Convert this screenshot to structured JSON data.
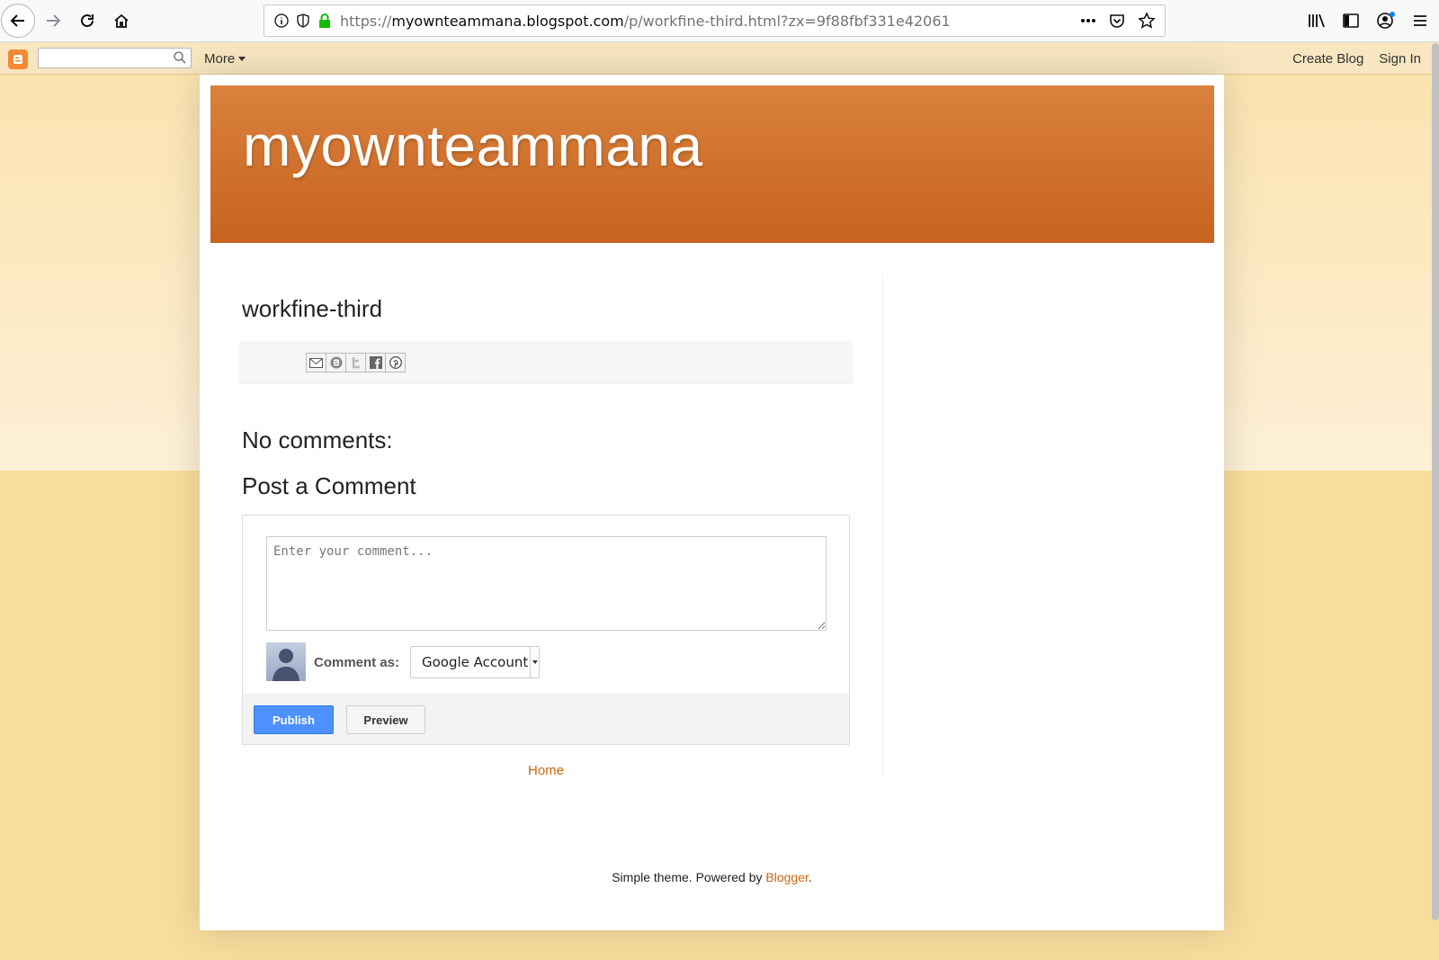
{
  "browser": {
    "url_prefix": "https://",
    "url_host": "myownteammana.blogspot.com",
    "url_path": "/p/workfine-third.html?zx=9f88fbf331e42061",
    "icons": [
      "back-icon",
      "forward-icon",
      "reload-icon",
      "home-icon",
      "info-icon",
      "tracking-shield-icon",
      "lock-icon",
      "page-actions-icon",
      "pocket-icon",
      "bookmark-star-icon",
      "library-icon",
      "sidebar-icon",
      "account-icon",
      "menu-icon"
    ]
  },
  "navbar": {
    "search_placeholder": "",
    "more_label": "More",
    "create_blog": "Create Blog",
    "sign_in": "Sign In"
  },
  "blog": {
    "title": "myownteammana"
  },
  "post": {
    "title": "workfine-third",
    "share_buttons": [
      "email-share-icon",
      "blogthis-share-icon",
      "twitter-share-icon",
      "facebook-share-icon",
      "pinterest-share-icon"
    ]
  },
  "comments": {
    "no_comments": "No comments:",
    "post_a_comment": "Post a Comment",
    "textarea_placeholder": "Enter your comment...",
    "comment_as_label": "Comment as:",
    "account_selected": "Google Account",
    "publish_label": "Publish",
    "preview_label": "Preview"
  },
  "links": {
    "home": "Home"
  },
  "footer": {
    "text": "Simple theme. Powered by ",
    "blogger_link": "Blogger",
    "period": "."
  },
  "colors": {
    "header_top": "#d9813d",
    "header_bottom": "#c7631f",
    "link": "#cc6611",
    "publish_blue": "#4d90fe",
    "backdrop": "#f9dd9e"
  }
}
